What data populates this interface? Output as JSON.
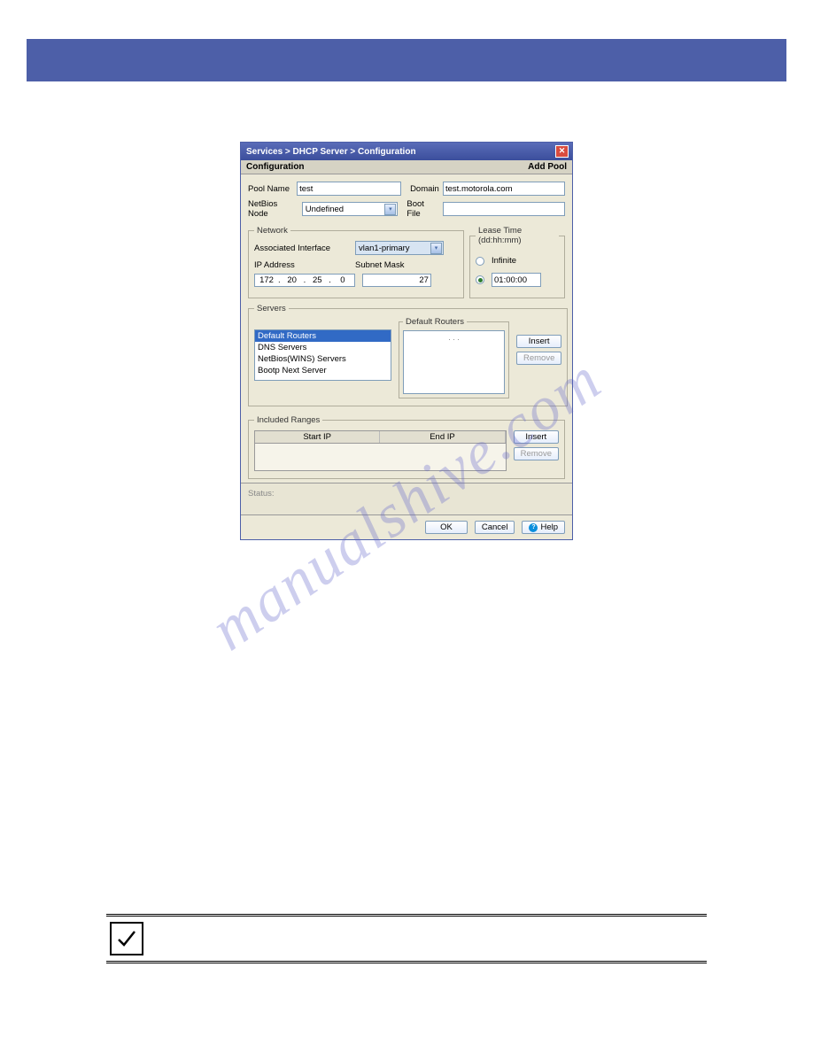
{
  "titlebar": {
    "breadcrumb": "Services > DHCP Server > Configuration"
  },
  "subheader": {
    "left": "Configuration",
    "right": "Add Pool"
  },
  "fields": {
    "pool_name_label": "Pool Name",
    "pool_name_value": "test",
    "domain_label": "Domain",
    "domain_value": "test.motorola.com",
    "netbios_label": "NetBios Node",
    "netbios_value": "Undefined",
    "bootfile_label": "Boot File",
    "bootfile_value": ""
  },
  "network": {
    "legend": "Network",
    "assoc_if_label": "Associated Interface",
    "assoc_if_value": "vlan1-primary",
    "ip_label": "IP Address",
    "subnet_label": "Subnet Mask",
    "ip_octets": [
      "172",
      "20",
      "25",
      "0"
    ],
    "subnet_suffix": "27"
  },
  "lease": {
    "legend": "Lease Time (dd:hh:mm)",
    "infinite_label": "Infinite",
    "time_value": "01:00:00"
  },
  "servers": {
    "legend": "Servers",
    "list": [
      "Default Routers",
      "DNS Servers",
      "NetBios(WINS) Servers",
      "Bootp Next Server"
    ],
    "routers_legend": "Default Routers",
    "routers_placeholder": ".   .   .",
    "insert_label": "Insert",
    "remove_label": "Remove"
  },
  "ranges": {
    "legend": "Included Ranges",
    "col_start": "Start IP",
    "col_end": "End IP",
    "insert_label": "Insert",
    "remove_label": "Remove"
  },
  "status": {
    "label": "Status:"
  },
  "buttons": {
    "ok": "OK",
    "cancel": "Cancel",
    "help": "Help"
  },
  "watermark": "manualshive.com"
}
